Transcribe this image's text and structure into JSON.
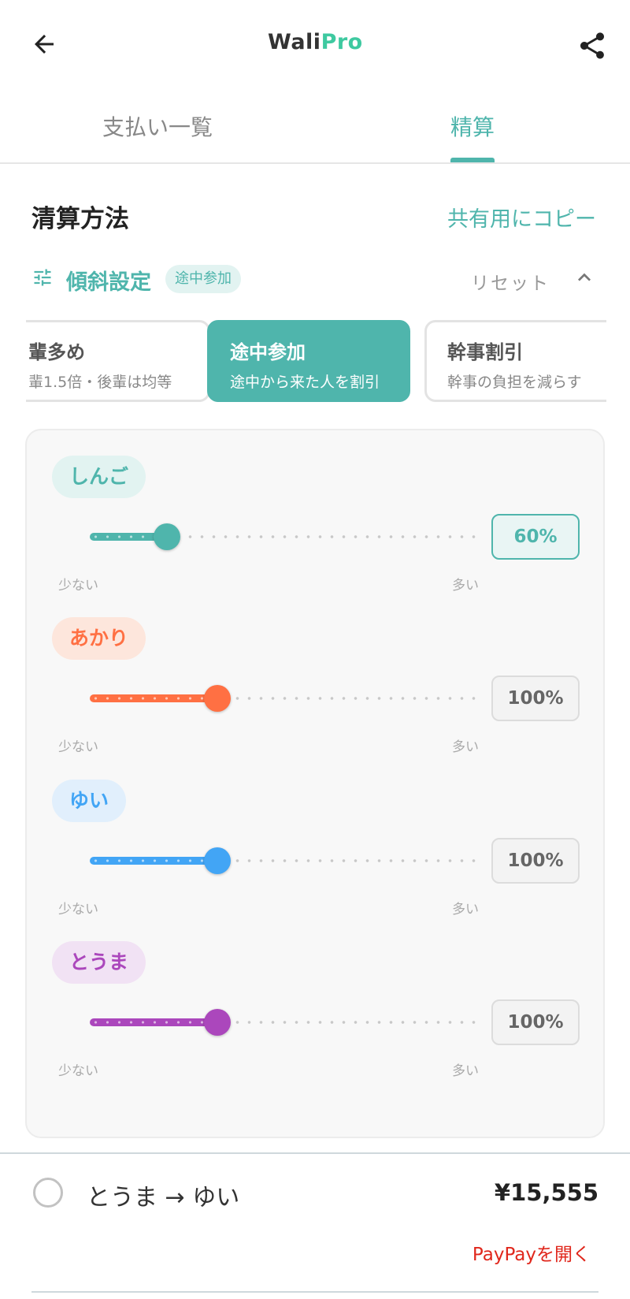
{
  "header": {
    "logo_prefix": "Wali",
    "logo_suffix": "Pro"
  },
  "tabs": [
    {
      "label": "支払い一覧",
      "active": false
    },
    {
      "label": "精算",
      "active": true
    }
  ],
  "settlement_method": {
    "title": "清算方法",
    "copy_label": "共有用にコピー"
  },
  "tilt": {
    "label": "傾斜設定",
    "badge": "途中参加",
    "reset_label": "リセット",
    "presets": [
      {
        "title": "輩多め",
        "subtitle": "輩1.5倍・後輩は均等",
        "selected": false
      },
      {
        "title": "途中参加",
        "subtitle": "途中から来た人を割引",
        "selected": true
      },
      {
        "title": "幹事割引",
        "subtitle": "幹事の負担を減らす",
        "selected": false
      }
    ]
  },
  "people": [
    {
      "name": "しんご",
      "value": "60%",
      "level": 0.2,
      "color": "#4fb5ac",
      "chip_bg": "#e2f3f1",
      "active": true
    },
    {
      "name": "あかり",
      "value": "100%",
      "level": 0.33,
      "color": "#ff7043",
      "chip_bg": "#fde6dc",
      "active": false
    },
    {
      "name": "ゆい",
      "value": "100%",
      "level": 0.33,
      "color": "#42a5f5",
      "chip_bg": "#e1effc",
      "active": false
    },
    {
      "name": "とうま",
      "value": "100%",
      "level": 0.33,
      "color": "#ab47bc",
      "chip_bg": "#f1e2f4",
      "active": false
    }
  ],
  "slider_labels": {
    "min": "少ない",
    "max": "多い"
  },
  "settlement": {
    "from_to": "とうま → ゆい",
    "amount": "¥15,555",
    "paypay_label": "PayPayを開く"
  },
  "colors": {
    "accent": "#4fb5ac",
    "paypay": "#e0271c"
  }
}
